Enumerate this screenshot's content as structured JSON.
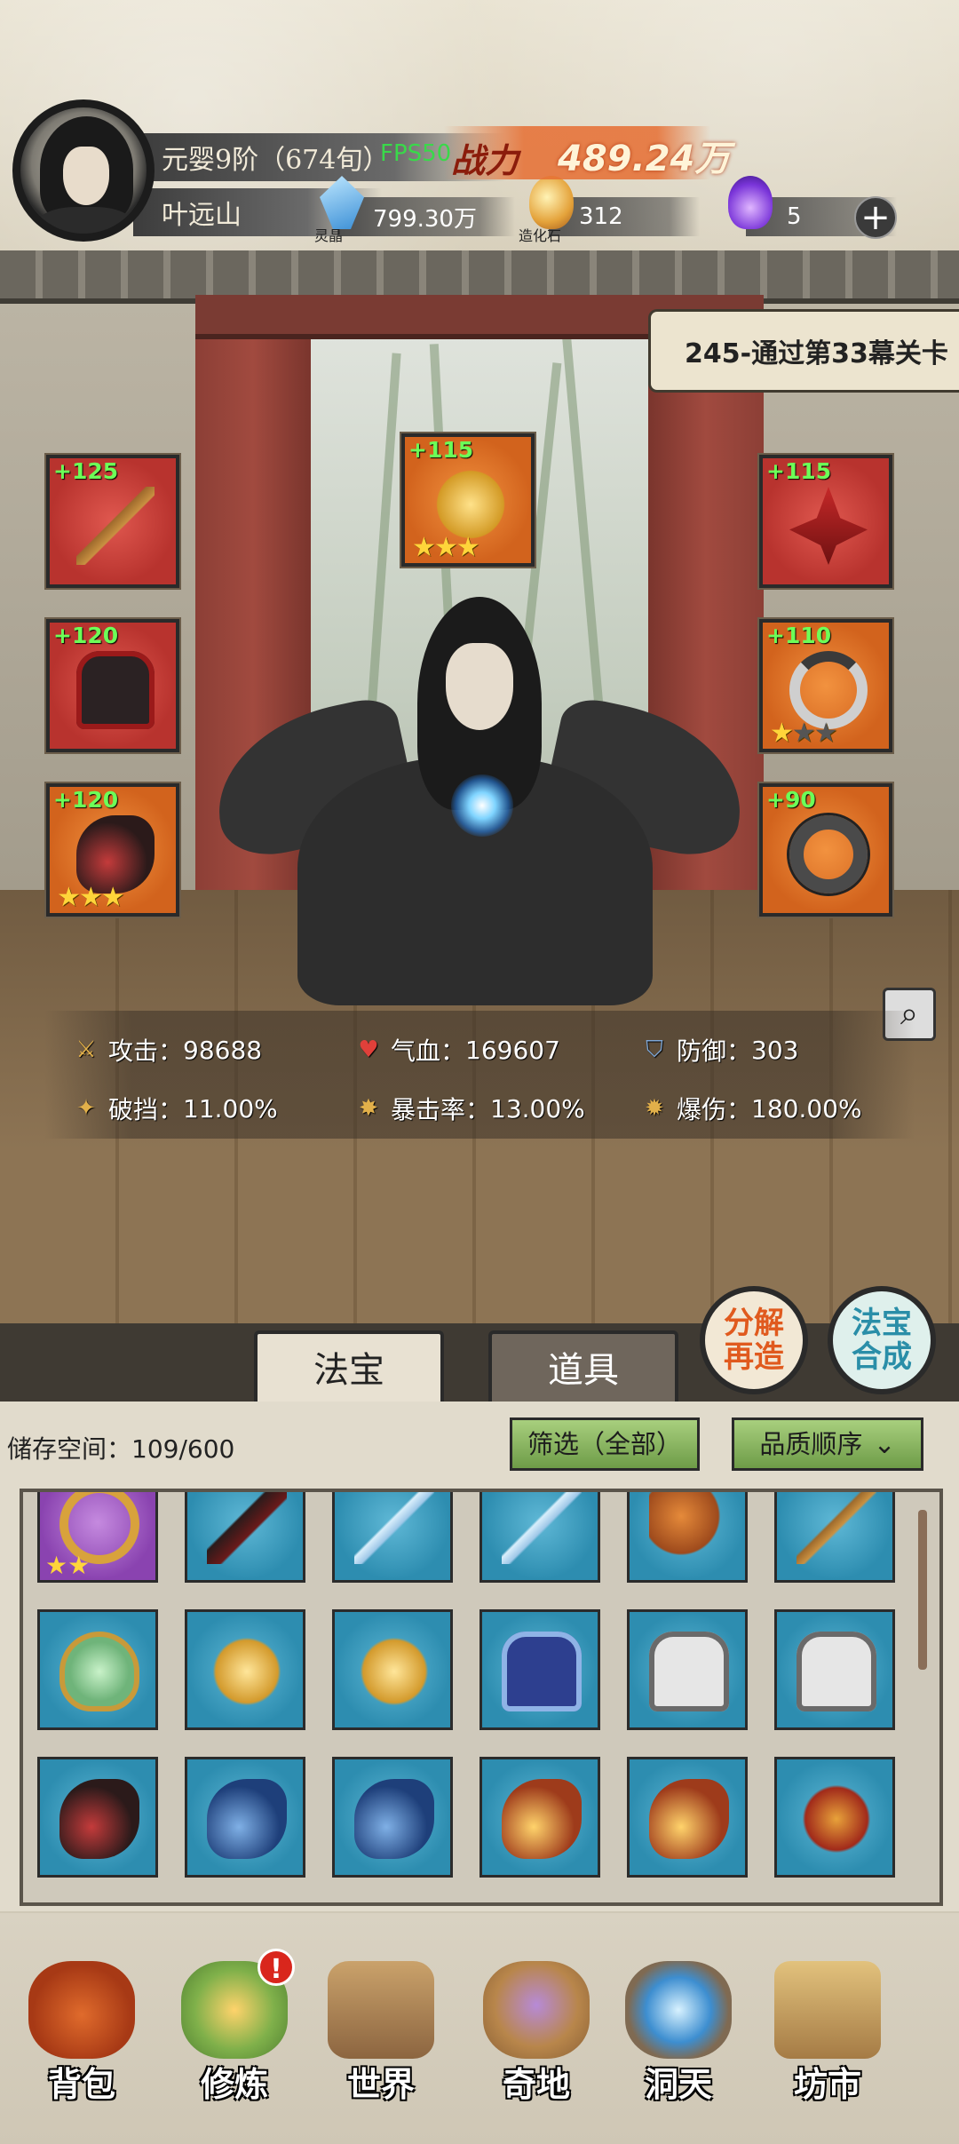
{
  "header": {
    "rank": "元婴9阶（674旬）",
    "player_name": "叶远山",
    "fps": "FPS50",
    "power_label": "战力",
    "power_value": "489.24万",
    "resources": [
      {
        "label": "灵晶",
        "value": "799.30万",
        "icon": "crystal-icon"
      },
      {
        "label": "造化石",
        "value": "312",
        "icon": "stone-icon"
      },
      {
        "label": "",
        "value": "5",
        "icon": "purple-flame-icon"
      }
    ],
    "add_label": "+"
  },
  "quest": {
    "text": "245-通过第33幕关卡"
  },
  "equipment": [
    {
      "slot": "weapon",
      "level": "+125",
      "stars": 0
    },
    {
      "slot": "armor",
      "level": "+120",
      "stars": 0
    },
    {
      "slot": "boots",
      "level": "+120",
      "stars": 3
    },
    {
      "slot": "charm",
      "level": "+115",
      "stars": 3
    },
    {
      "slot": "crown",
      "level": "+115",
      "stars": 0
    },
    {
      "slot": "necklace",
      "level": "+110",
      "stars": 1
    },
    {
      "slot": "ring",
      "level": "+90",
      "stars": 0
    }
  ],
  "stats": {
    "attack": {
      "label": "攻击：",
      "value": "98688"
    },
    "hp": {
      "label": "气血：",
      "value": "169607"
    },
    "defense": {
      "label": "防御：",
      "value": "303"
    },
    "penetration": {
      "label": "破挡：",
      "value": "11.00%"
    },
    "crit_rate": {
      "label": "暴击率：",
      "value": "13.00%"
    },
    "crit_damage": {
      "label": "爆伤：",
      "value": "180.00%"
    }
  },
  "actions": {
    "decompose": "分解再造",
    "synthesize": "法宝合成"
  },
  "tabs": [
    {
      "label": "法宝",
      "active": true
    },
    {
      "label": "道具",
      "active": false
    }
  ],
  "inventory": {
    "storage_label": "储存空间：",
    "storage_value": "109/600",
    "filter_label": "筛选（全部）",
    "sort_label": "品质顺序",
    "rows": [
      [
        "gold-bracelet",
        "dark-dagger",
        "ice-sword",
        "ice-sword",
        "axe",
        "staff"
      ],
      [
        "jade-mirror",
        "gold-lotus",
        "gold-lotus",
        "blue-robe",
        "white-armor",
        "white-armor"
      ],
      [
        "red-boots",
        "blue-boots",
        "blue-boots",
        "gold-boots",
        "gold-boots",
        "fire-ring"
      ]
    ]
  },
  "nav": [
    {
      "label": "背包",
      "icon": "bag-icon",
      "active": true
    },
    {
      "label": "修炼",
      "icon": "lotus-icon",
      "badge": "!"
    },
    {
      "label": "世界",
      "icon": "scroll-map-icon"
    },
    {
      "label": "奇地",
      "icon": "mountain-icon"
    },
    {
      "label": "洞天",
      "icon": "portal-icon"
    },
    {
      "label": "坊市",
      "icon": "market-icon"
    }
  ],
  "colors": {
    "level_green": "#6cff58",
    "star_gold": "#ffd53a",
    "power_accent": "#e66e32",
    "slot_red": "#b8332e",
    "slot_orange": "#d2631d",
    "grid_blue": "#2d8db0"
  }
}
